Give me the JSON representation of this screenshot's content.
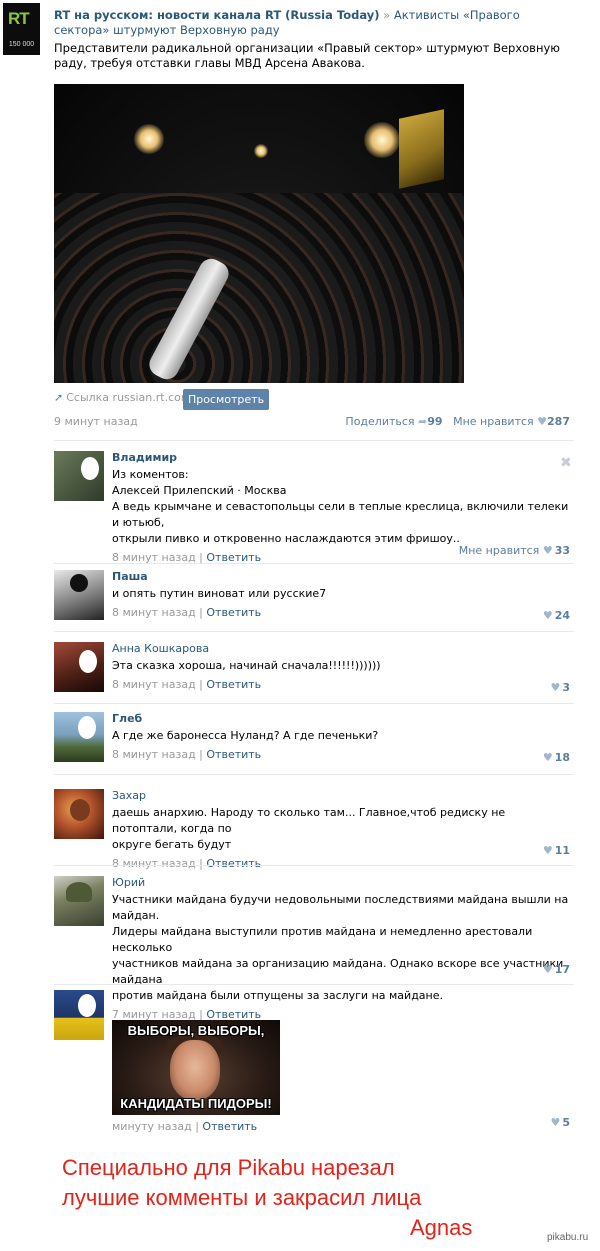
{
  "header": {
    "logo_text": "RT",
    "logo_sub": "150 000",
    "channel_name": "RT на русском: новости канала RT (Russia Today)",
    "separator": " » ",
    "post_title": "Активисты «Правого сектора» штурмуют Верховную раду",
    "post_text": "Представители радикальной организации «Правый сектор» штурмуют Верховную раду, требуя отставки главы МВД Арсена Авакова."
  },
  "video": {
    "link_label": "Ссылка russian.rt.com",
    "view_button": "Просмотреть"
  },
  "post_meta": {
    "time": "9 минут назад",
    "share_label": "Поделиться",
    "share_count": "99",
    "like_label": "Мне нравится",
    "like_count": "287"
  },
  "comments": [
    {
      "name": "Владимир",
      "text_lines": [
        "Из коментов:",
        "Алексей Прилепский · Москва",
        "А ведь крымчане и севастопольцы сели в теплые креслица, включили телеки и ютьюб,",
        "открыли пивко и откровенно наслаждаются этим фришоу.."
      ],
      "time": "8 минут назад",
      "reply": "Ответить",
      "like_label": "Мне нравится",
      "likes": "33"
    },
    {
      "name": "Паша",
      "text_lines": [
        "и опять путин виноват или русские7"
      ],
      "time": "8 минут назад",
      "reply": "Ответить",
      "likes": "24"
    },
    {
      "name": "Анна Кошкарова",
      "text_lines": [
        "Эта сказка хороша, начинай сначала!!!!!!))))))"
      ],
      "time": "8 минут назад",
      "reply": "Ответить",
      "likes": "3"
    },
    {
      "name": "Глеб",
      "text_lines": [
        "А где же баронесса Нуланд? А где печеньки?"
      ],
      "time": "8 минут назад",
      "reply": "Ответить",
      "likes": "18"
    },
    {
      "name": "Захар",
      "text_lines": [
        "даешь анархию. Народу то сколько там... Главное,чтоб редиску не потоптали, когда по",
        "округе бегать будут"
      ],
      "time": "8 минут назад",
      "reply": "Ответить",
      "likes": "11"
    },
    {
      "name": "Юрий",
      "text_lines": [
        "Участники майдана будучи недовольными последствиями майдана вышли на майдан.",
        "Лидеры майдана выступили против майдана и немедленно арестовали несколько",
        "участников майдана за организацию майдана. Однако вскоре все участники майдана",
        "против майдана были отпущены за заслуги на майдане."
      ],
      "time": "7 минут назад",
      "reply": "Ответить",
      "likes": "17"
    },
    {
      "name": "",
      "text_lines": [],
      "meme_top": "ВЫБОРЫ, ВЫБОРЫ,",
      "meme_bottom": "КАНДИДАТЫ ПИДОРЫ!",
      "time": "минуту назад",
      "reply": "Ответить",
      "likes": "5"
    }
  ],
  "footer": {
    "line1": "Специально для Pikabu нарезал",
    "line2": "лучшие комменты и закрасил лица",
    "line3": "Agnas",
    "watermark": "pikabu.ru"
  },
  "colors": {
    "link": "#2b587a",
    "meta_gray": "#999999",
    "button": "#5e82a8",
    "footer_red": "#e2231a"
  }
}
